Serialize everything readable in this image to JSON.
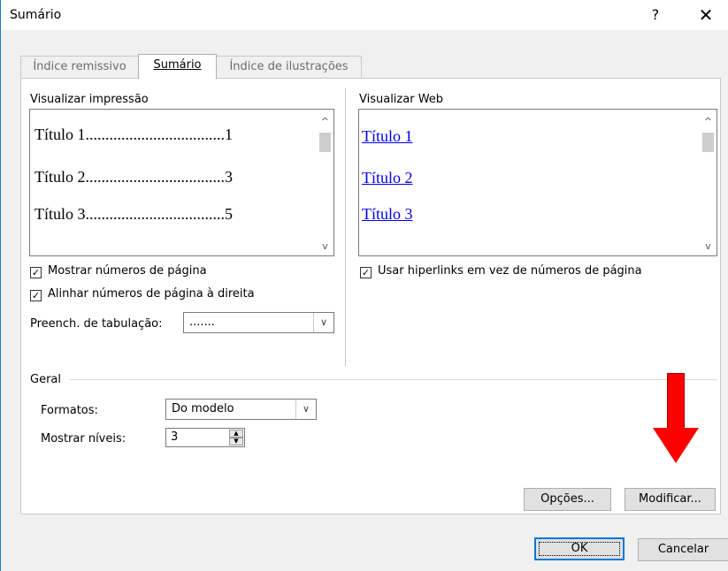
{
  "dialog": {
    "title": "Sumário",
    "help_label": "?",
    "close_label": "✕"
  },
  "tabs": [
    {
      "label": "Índice remissivo",
      "active": false
    },
    {
      "label": "Sumário",
      "active": true
    },
    {
      "label": "Índice de ilustrações",
      "active": false
    }
  ],
  "print_preview": {
    "label": "Visualizar impressão",
    "lines": [
      {
        "text": "Título 1",
        "dots": "...................................",
        "page": "1"
      },
      {
        "text": "Título 2",
        "dots": "...................................",
        "page": "3"
      },
      {
        "text": "Título 3",
        "dots": "...................................",
        "page": "5"
      }
    ]
  },
  "web_preview": {
    "label": "Visualizar Web",
    "links": [
      "Título 1",
      "Título 2",
      "Título 3"
    ]
  },
  "options": {
    "show_page_numbers": {
      "label": "Mostrar números de página",
      "checked": true
    },
    "align_right": {
      "label": "Alinhar números de página à direita",
      "checked": true
    },
    "tab_leader": {
      "label": "Preench. de tabulação:",
      "value": "......."
    },
    "use_hyperlinks": {
      "label": "Usar hiperlinks em vez de números de página",
      "checked": true
    }
  },
  "general": {
    "label": "Geral",
    "formats": {
      "label": "Formatos:",
      "value": "Do modelo"
    },
    "levels": {
      "label": "Mostrar níveis:",
      "value": "3"
    }
  },
  "buttons": {
    "options": "Opções...",
    "modify": "Modificar...",
    "ok": "OK",
    "cancel": "Cancelar"
  },
  "annotation": {
    "arrow_color": "#ff0000"
  },
  "icons": {
    "checkmark": "✓",
    "scroll_up": "^",
    "scroll_down": "v",
    "dropdown": "∨",
    "spin_up": "▲",
    "spin_down": "▼"
  }
}
